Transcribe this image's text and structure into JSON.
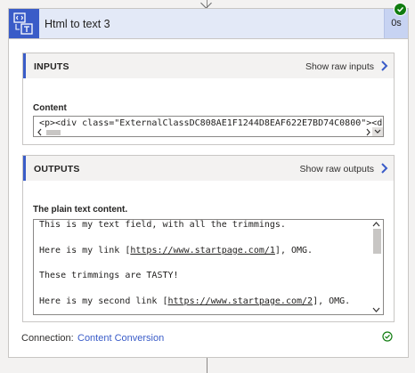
{
  "action": {
    "title": "Html to text 3",
    "duration": "0s",
    "status_color": "#107c10",
    "icon": "html-to-text-icon"
  },
  "inputs": {
    "title": "INPUTS",
    "raw_link": "Show raw inputs",
    "field_label": "Content",
    "field_value": "<p><div class=\"ExternalClassDC808AE1F1244D8EAF622E7BD74C0800\"><div"
  },
  "outputs": {
    "title": "OUTPUTS",
    "raw_link": "Show raw outputs",
    "field_label": "The plain text content.",
    "lines": [
      "This is my text field, with all the trimmings.",
      "",
      "Here is my link [https://www.startpage.com/1], OMG.",
      "",
      "These trimmings are TASTY!",
      "",
      "Here is my second link [https://www.startpage.com/2], OMG."
    ],
    "link1": "https://www.startpage.com/1",
    "link2": "https://www.startpage.com/2"
  },
  "connection": {
    "label": "Connection:",
    "value": "Content Conversion"
  },
  "colors": {
    "accent": "#3a5cc8",
    "success": "#107c10",
    "header_bg": "#e3e9f7"
  }
}
